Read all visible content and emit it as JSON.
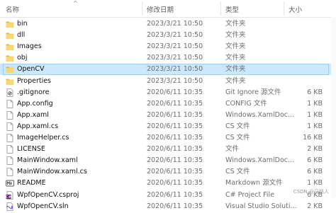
{
  "columns": {
    "name": "名称",
    "date": "修改日期",
    "type": "类型",
    "size": "大小"
  },
  "sort_indicator": "^",
  "rows": [
    {
      "name": "bin",
      "date": "2023/3/21 10:50",
      "type": "文件夹",
      "size": "",
      "icon": "folder-icon",
      "selected": false
    },
    {
      "name": "dll",
      "date": "2023/3/21 10:50",
      "type": "文件夹",
      "size": "",
      "icon": "folder-icon",
      "selected": false
    },
    {
      "name": "Images",
      "date": "2023/3/21 10:50",
      "type": "文件夹",
      "size": "",
      "icon": "folder-icon",
      "selected": false
    },
    {
      "name": "obj",
      "date": "2023/3/21 10:50",
      "type": "文件夹",
      "size": "",
      "icon": "folder-icon",
      "selected": false
    },
    {
      "name": "OpenCV",
      "date": "2023/3/21 10:50",
      "type": "文件夹",
      "size": "",
      "icon": "folder-icon",
      "selected": true
    },
    {
      "name": "Properties",
      "date": "2023/3/21 10:50",
      "type": "文件夹",
      "size": "",
      "icon": "folder-icon",
      "selected": false
    },
    {
      "name": ".gitignore",
      "date": "2020/6/11 10:35",
      "type": "Git Ignore 源文件",
      "size": "6 KB",
      "icon": "gitignore-file-icon",
      "selected": false
    },
    {
      "name": "App.config",
      "date": "2020/6/11 10:35",
      "type": "CONFIG 文件",
      "size": "1 KB",
      "icon": "document-file-icon",
      "selected": false
    },
    {
      "name": "App.xaml",
      "date": "2020/6/11 10:35",
      "type": "Windows.XamlDoc...",
      "size": "1 KB",
      "icon": "document-file-icon",
      "selected": false
    },
    {
      "name": "App.xaml.cs",
      "date": "2020/6/11 10:35",
      "type": "CS 文件",
      "size": "1 KB",
      "icon": "document-file-icon",
      "selected": false
    },
    {
      "name": "ImageHelper.cs",
      "date": "2020/6/11 10:35",
      "type": "CS 文件",
      "size": "16 KB",
      "icon": "document-file-icon",
      "selected": false
    },
    {
      "name": "LICENSE",
      "date": "2020/6/11 10:35",
      "type": "文件",
      "size": "2 KB",
      "icon": "document-file-icon",
      "selected": false
    },
    {
      "name": "MainWindow.xaml",
      "date": "2020/6/11 10:35",
      "type": "Windows.XamlDoc...",
      "size": "6 KB",
      "icon": "document-file-icon",
      "selected": false
    },
    {
      "name": "MainWindow.xaml.cs",
      "date": "2020/6/11 10:35",
      "type": "CS 文件",
      "size": "6 KB",
      "icon": "document-file-icon",
      "selected": false
    },
    {
      "name": "README",
      "date": "2020/6/11 10:35",
      "type": "Markdown 源文件",
      "size": "1 KB",
      "icon": "markdown-file-icon",
      "selected": false
    },
    {
      "name": "WpfOpenCV.csproj",
      "date": "2020/6/11 10:35",
      "type": "C# Project File",
      "size": "6 KB",
      "icon": "csproj-file-icon",
      "selected": false
    },
    {
      "name": "WpfOpenCV.sln",
      "date": "2020/6/11 10:35",
      "type": "Visual Studio Soluti...",
      "size": "2 KB",
      "icon": "sln-file-icon",
      "selected": false
    }
  ],
  "watermark": "CSDN @马路人",
  "colors": {
    "folder": "#f8d775",
    "folder_dark": "#e8b830",
    "selection_fill": "#cce8ff",
    "selection_border": "#99d1ff",
    "csharp": "#68217a",
    "vs_purple": "#8661c5"
  }
}
